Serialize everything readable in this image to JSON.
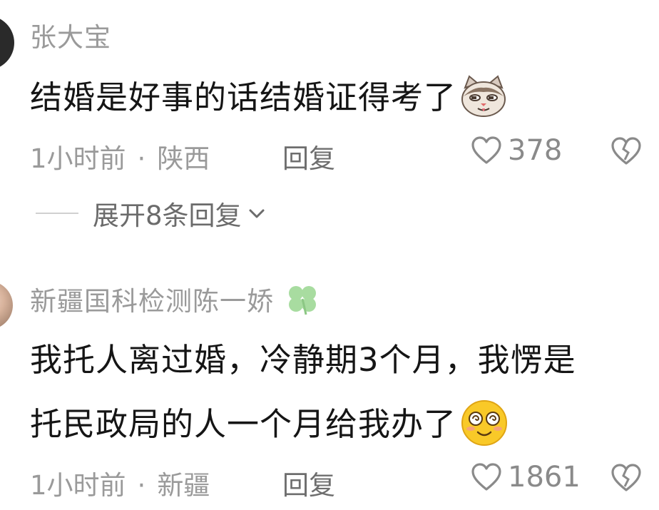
{
  "comments": [
    {
      "username": "张大宝",
      "text_lines": [
        "结婚是好事的话结婚证得考了"
      ],
      "time": "1小时前",
      "separator": "·",
      "location": "陕西",
      "reply_label": "回复",
      "likes": "378",
      "emoji": "cat-face-icon"
    },
    {
      "username": "新疆国科检测陈一娇",
      "username_badge": "clover-icon",
      "text_lines": [
        "我托人离过婚，冷静期3个月，我愣是",
        "托民政局的人一个月给我办了"
      ],
      "time": "1小时前",
      "separator": "·",
      "location": "新疆",
      "reply_label": "回复",
      "likes": "1861",
      "emoji": "dazed-face-icon"
    }
  ],
  "expand_replies": {
    "label": "展开8条回复"
  },
  "colors": {
    "meta_gray": "#9a9a9a",
    "text": "#151515",
    "clover_green": "#a8dca0",
    "emoji_yellow": "#f9c928"
  }
}
